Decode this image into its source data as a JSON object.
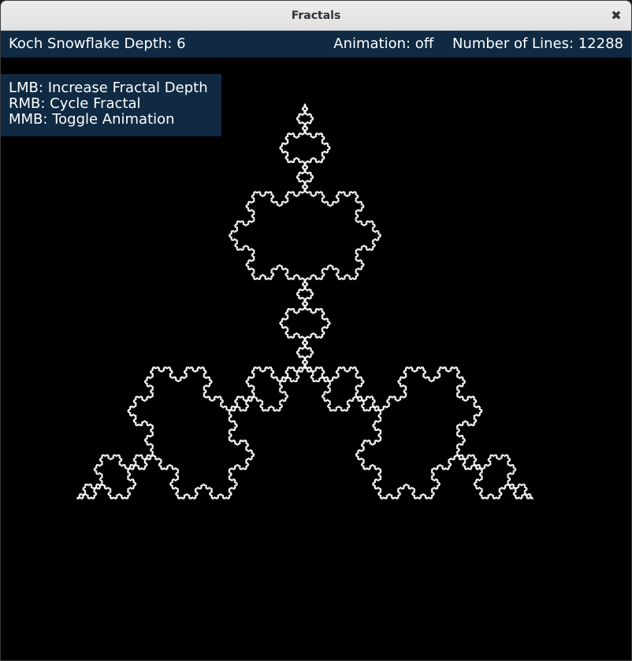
{
  "window": {
    "title": "Fractals",
    "close_icon": "close-icon"
  },
  "status": {
    "fractal_label": "Koch Snowflake Depth: 6",
    "animation_label": "Animation: off",
    "lines_label": "Number of Lines: 12288"
  },
  "help": {
    "lines": [
      "LMB: Increase Fractal Depth",
      "RMB: Cycle Fractal",
      "MMB: Toggle Animation"
    ]
  },
  "fractal": {
    "type": "koch-snowflake",
    "depth": 6,
    "line_count": 12288,
    "animation": "off",
    "line_color": "#ffffff",
    "background_color": "#000000"
  },
  "colors": {
    "panel_bg": "#0f2a42",
    "panel_text": "#ffffff"
  }
}
